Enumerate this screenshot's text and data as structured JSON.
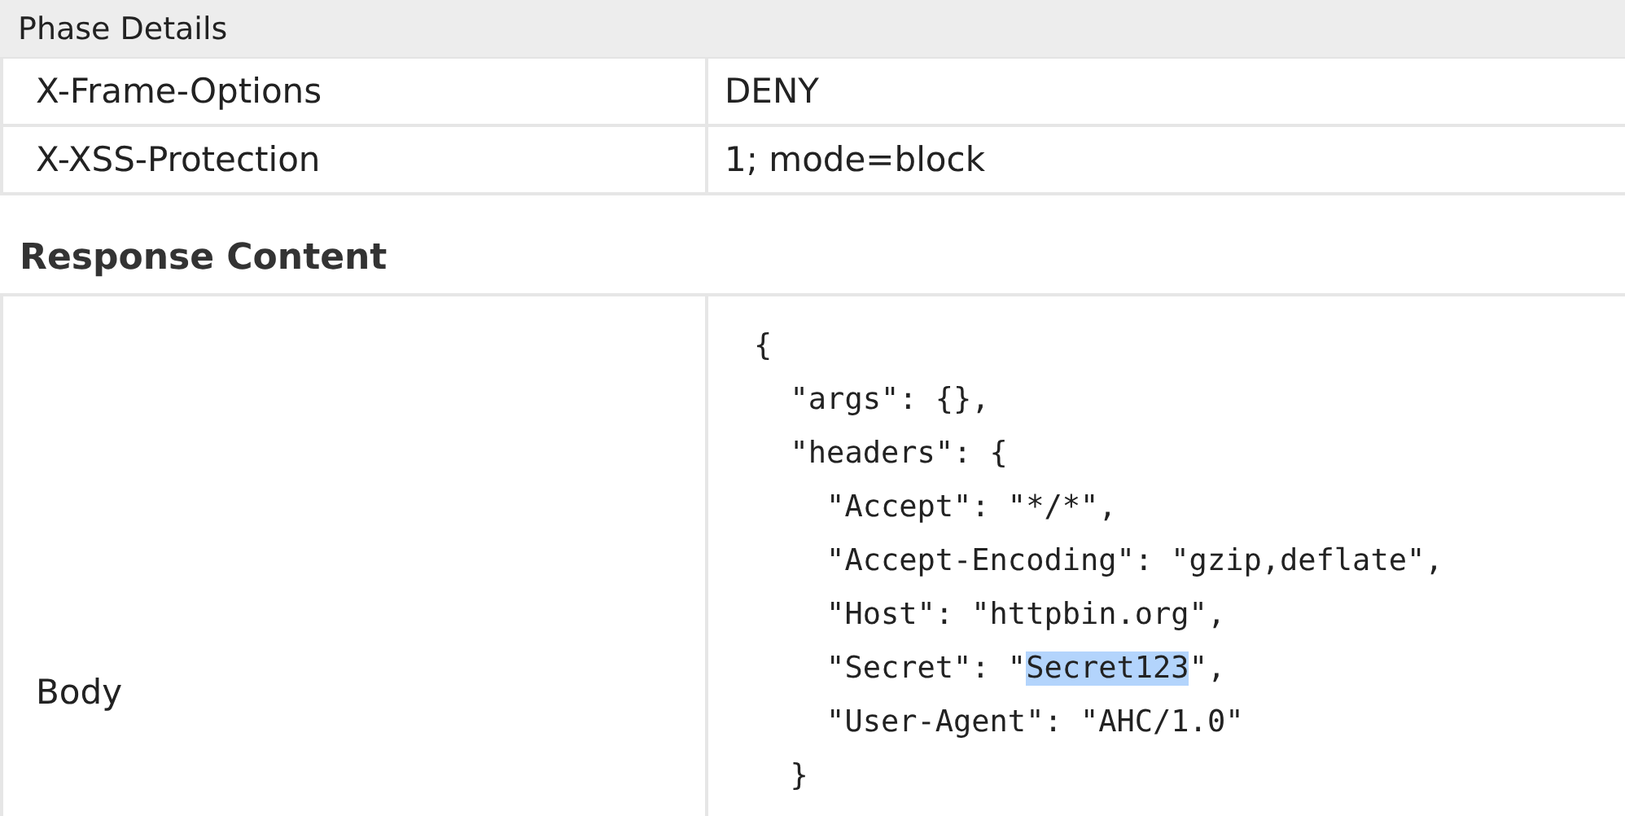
{
  "header": {
    "title": "Phase Details"
  },
  "header_rows": [
    {
      "name": "X-Frame-Options",
      "value": "DENY"
    },
    {
      "name": "X-XSS-Protection",
      "value": "1; mode=block"
    }
  ],
  "response_content": {
    "heading": "Response Content",
    "label": "Body",
    "code_lines": [
      [
        {
          "text": "{",
          "selected": false
        }
      ],
      [
        {
          "text": "  \"args\": {},",
          "selected": false
        }
      ],
      [
        {
          "text": "  \"headers\": {",
          "selected": false
        }
      ],
      [
        {
          "text": "    \"Accept\": \"*/*\",",
          "selected": false
        }
      ],
      [
        {
          "text": "    \"Accept-Encoding\": \"gzip,deflate\",",
          "selected": false
        }
      ],
      [
        {
          "text": "    \"Host\": \"httpbin.org\",",
          "selected": false
        }
      ],
      [
        {
          "text": "    \"Secret\": \"",
          "selected": false
        },
        {
          "text": "Secret123",
          "selected": true
        },
        {
          "text": "\",",
          "selected": false
        }
      ],
      [
        {
          "text": "    \"User-Agent\": \"AHC/1.0\"",
          "selected": false
        }
      ],
      [
        {
          "text": "  }",
          "selected": false
        }
      ]
    ]
  }
}
